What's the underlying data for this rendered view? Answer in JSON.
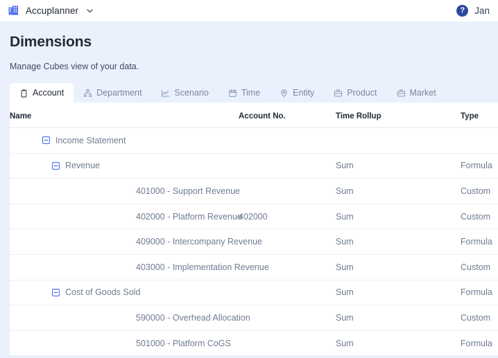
{
  "appbar": {
    "brand_icon": "building-icon",
    "brand_name": "Accuplanner",
    "brand_chevron_icon": "chevron-down-icon",
    "help_icon_label": "?",
    "user_name": "Jan",
    "accent_blue": "#4a6ef0",
    "help_badge_color": "#2b4a9e"
  },
  "page": {
    "title": "Dimensions",
    "subtitle": "Manage Cubes view of your data.",
    "background": "#eaf1fd"
  },
  "tabs": [
    {
      "label": "Account",
      "icon": "clipboard-icon",
      "active": true
    },
    {
      "label": "Department",
      "icon": "org-chart-icon",
      "active": false
    },
    {
      "label": "Scenario",
      "icon": "line-chart-icon",
      "active": false
    },
    {
      "label": "Time",
      "icon": "calendar-icon",
      "active": false
    },
    {
      "label": "Entity",
      "icon": "map-pin-icon",
      "active": false
    },
    {
      "label": "Product",
      "icon": "briefcase-icon",
      "active": false
    },
    {
      "label": "Market",
      "icon": "briefcase-icon",
      "active": false
    }
  ],
  "table": {
    "columns": [
      "Name",
      "Account No.",
      "Time Rollup",
      "Type"
    ],
    "rows": [
      {
        "name": "Income Statement",
        "level": 0,
        "toggle": "collapse-minus-icon",
        "account_no": "",
        "time_rollup": "",
        "type": ""
      },
      {
        "name": "Revenue",
        "level": 1,
        "toggle": "collapse-minus-icon",
        "account_no": "",
        "time_rollup": "Sum",
        "type": "Formula"
      },
      {
        "name": "401000 - Support Revenue",
        "level": 2,
        "toggle": "",
        "account_no": "",
        "time_rollup": "Sum",
        "type": "Custom"
      },
      {
        "name": "402000 - Platform Revenue",
        "level": 2,
        "toggle": "",
        "account_no": "402000",
        "time_rollup": "Sum",
        "type": "Custom"
      },
      {
        "name": "409000 - Intercompany Revenue",
        "level": 2,
        "toggle": "",
        "account_no": "",
        "time_rollup": "Sum",
        "type": "Formula"
      },
      {
        "name": "403000 - Implementation Revenue",
        "level": 2,
        "toggle": "",
        "account_no": "",
        "time_rollup": "Sum",
        "type": "Custom"
      },
      {
        "name": "Cost of Goods Sold",
        "level": 1,
        "toggle": "collapse-minus-icon",
        "account_no": "",
        "time_rollup": "Sum",
        "type": "Formula"
      },
      {
        "name": "590000 - Overhead Allocation",
        "level": 2,
        "toggle": "",
        "account_no": "",
        "time_rollup": "Sum",
        "type": "Custom"
      },
      {
        "name": "501000 - Platform CoGS",
        "level": 2,
        "toggle": "",
        "account_no": "",
        "time_rollup": "Sum",
        "type": "Formula"
      }
    ]
  }
}
